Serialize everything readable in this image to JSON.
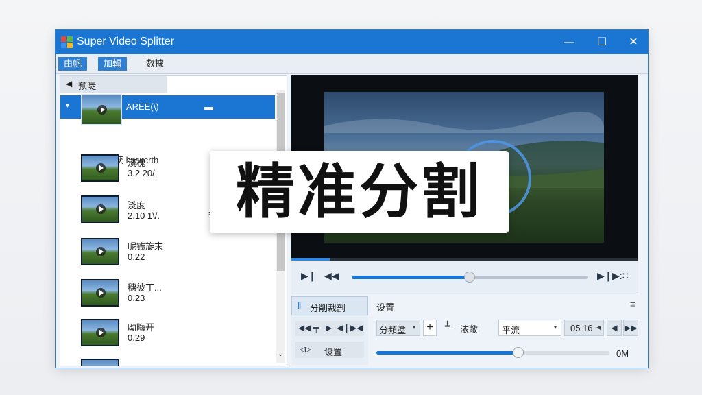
{
  "window": {
    "title": "Super Video Splitter",
    "minimize": "—",
    "maximize": "☐",
    "close": "✕"
  },
  "menu": [
    {
      "label": "由帆",
      "active": true
    },
    {
      "label": "加輻",
      "active": true
    },
    {
      "label": "数據",
      "active": false
    }
  ],
  "library": {
    "header": "预陡",
    "back_arrow": "◀",
    "selected": {
      "chevron": "▾",
      "label": "AREE(\\)",
      "dash": "▬"
    },
    "group_label": "侧准编获 hwwcrth",
    "items": [
      {
        "name": "濱槐",
        "value": "3.2 20/."
      },
      {
        "name": "淺度",
        "value": "2.10 1\\/."
      },
      {
        "name": "呢镄旋末",
        "value": "0.22"
      },
      {
        "name": "穗彼丁...",
        "value": "0.23"
      },
      {
        "name": "呦晦开",
        "value": "0.29"
      },
      {
        "name": "",
        "value": ""
      }
    ],
    "eq_mark": "=",
    "scroll_down": "⌄"
  },
  "player": {
    "progress": 0.11,
    "play_icon": "▶❙",
    "rewind_icon": "◀◀",
    "seek_position": 0.5,
    "next_icon": "▶❙",
    "end_icon": "▶:∷"
  },
  "split_panel": {
    "tab_icon": "‖",
    "tab_label": "分削裁剖",
    "icons": [
      "◀◀",
      "╤",
      "▶",
      "◀❙",
      "▶◀"
    ],
    "settings_icon": "◁▷",
    "settings_label": "设置"
  },
  "settings": {
    "title": "设置",
    "menu_icon": "≡",
    "mode": "分頻塗",
    "mode_caret": "▾",
    "plus": "+",
    "tool_icon": "┻",
    "tool_label": "浓敞",
    "quality": "平流",
    "quality_caret": "▾",
    "time": "05 16",
    "time_caret": "◀",
    "prev": "◀",
    "next": "▶▶",
    "volume_position": 0.61,
    "volume_label": "0M"
  },
  "overlay": {
    "text": "精准分割"
  }
}
